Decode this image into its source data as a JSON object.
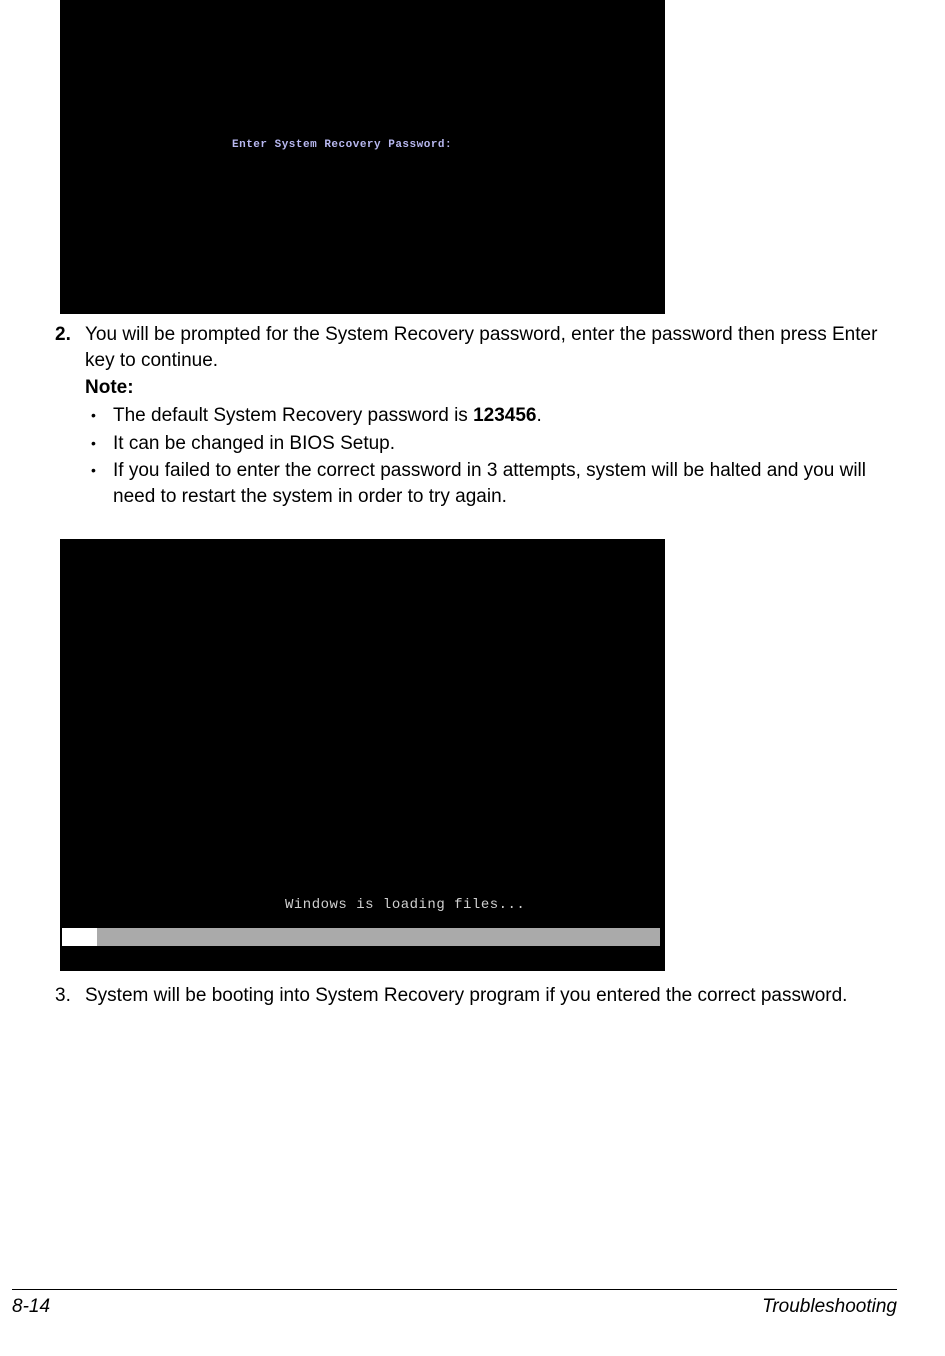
{
  "screenshot1": {
    "prompt_text": "Enter System Recovery Password:"
  },
  "step2": {
    "number": "2.",
    "text": "You will be prompted for the System Recovery password, enter the password then press Enter key to continue."
  },
  "note": {
    "label": "Note:",
    "items": [
      {
        "prefix": "The default System Recovery password is ",
        "bold": "123456",
        "suffix": "."
      },
      {
        "text": "It can be changed in BIOS Setup."
      },
      {
        "text": "If you failed to enter the correct password in 3 attempts, system will be halted and you will need to restart the system in order to try again."
      }
    ]
  },
  "screenshot2": {
    "loading_text": "Windows is loading files..."
  },
  "step3": {
    "number": "3.",
    "text": "System will be booting into System Recovery program if you entered the correct password."
  },
  "footer": {
    "page": "8-14",
    "section": "Troubleshooting"
  }
}
